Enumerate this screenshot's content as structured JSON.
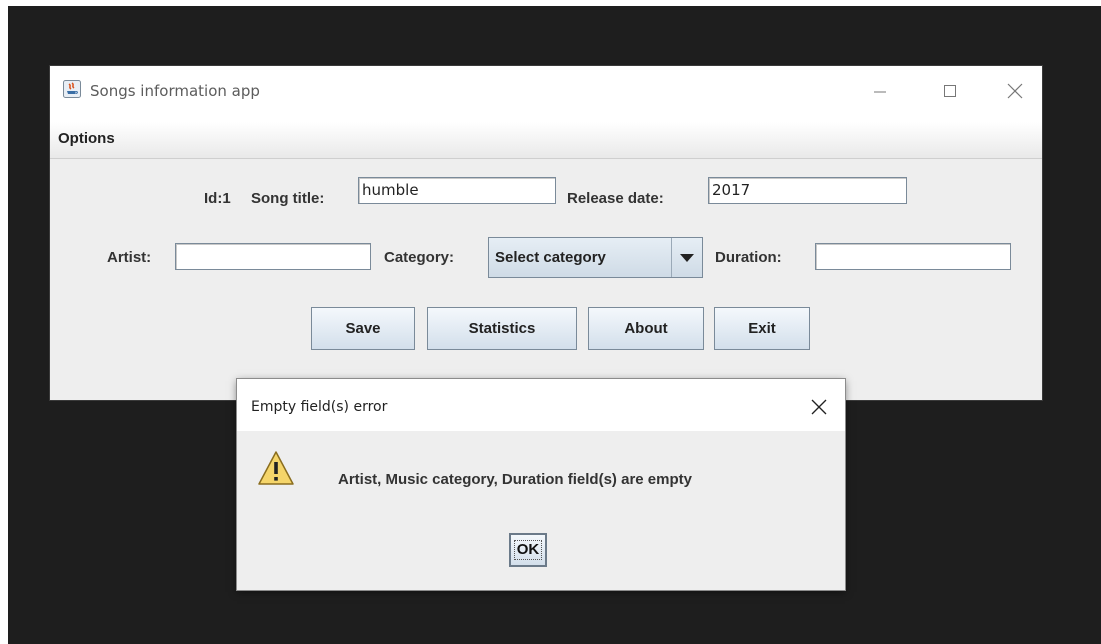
{
  "window": {
    "title": "Songs information app",
    "controls": {
      "minimize": "minimize",
      "maximize": "maximize",
      "close": "close"
    }
  },
  "menubar": {
    "options": "Options"
  },
  "form": {
    "id_label": "Id:1",
    "song_title_label": "Song title:",
    "song_title_value": "humble",
    "release_date_label": "Release date:",
    "release_date_value": "2017",
    "artist_label": "Artist:",
    "artist_value": "",
    "category_label": "Category:",
    "category_selected": "Select  category",
    "duration_label": "Duration:",
    "duration_value": ""
  },
  "buttons": {
    "save": "Save",
    "statistics": "Statistics",
    "about": "About",
    "exit": "Exit"
  },
  "dialog": {
    "title": "Empty field(s) error",
    "message": "Artist, Music category, Duration field(s) are empty",
    "ok": "OK",
    "icon": "warning-icon"
  },
  "colors": {
    "desktop": "#1e1e1e",
    "window_bg": "#eeeeee",
    "button_gradient_top": "#f4f8fc",
    "button_gradient_bottom": "#d3dfeb",
    "warning_yellow": "#f5d56a"
  }
}
